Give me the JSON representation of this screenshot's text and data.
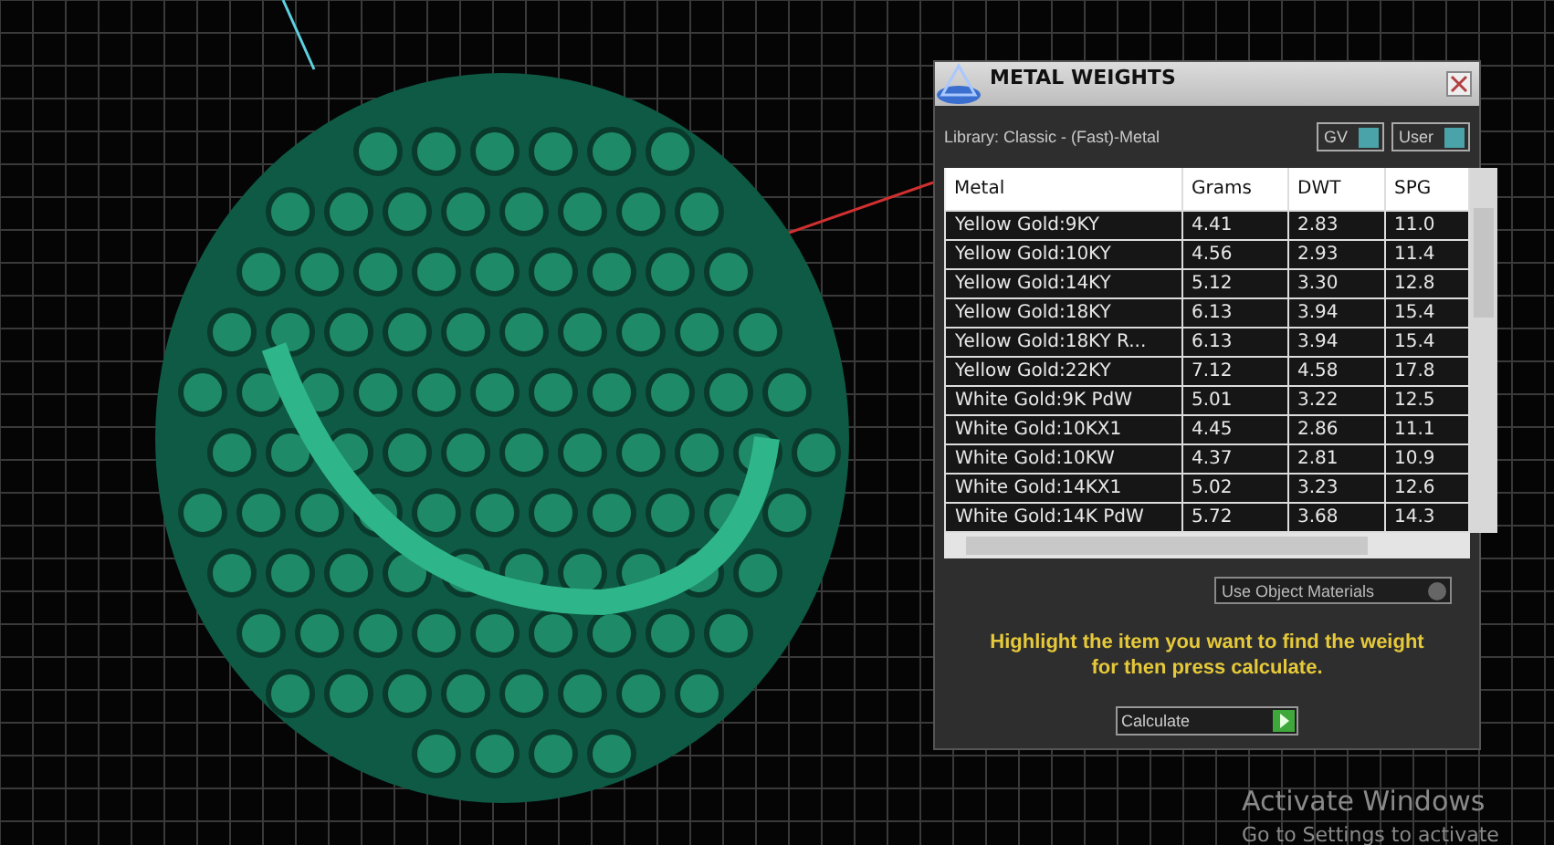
{
  "panel": {
    "title": "METAL WEIGHTS",
    "library": "Library: Classic - (Fast)-Metal",
    "toggles": [
      "GV",
      "User"
    ],
    "table": {
      "columns": [
        "Metal",
        "Grams",
        "DWT",
        "SPG"
      ],
      "rows": [
        [
          "Yellow Gold:9KY",
          "4.41",
          "2.83",
          "11.0"
        ],
        [
          "Yellow Gold:10KY",
          "4.56",
          "2.93",
          "11.4"
        ],
        [
          "Yellow Gold:14KY",
          "5.12",
          "3.30",
          "12.8"
        ],
        [
          "Yellow Gold:18KY",
          "6.13",
          "3.94",
          "15.4"
        ],
        [
          "Yellow Gold:18KY R...",
          "6.13",
          "3.94",
          "15.4"
        ],
        [
          "Yellow Gold:22KY",
          "7.12",
          "4.58",
          "17.8"
        ],
        [
          "White Gold:9K PdW",
          "5.01",
          "3.22",
          "12.5"
        ],
        [
          "White Gold:10KX1",
          "4.45",
          "2.86",
          "11.1"
        ],
        [
          "White Gold:10KW",
          "4.37",
          "2.81",
          "10.9"
        ],
        [
          "White Gold:14KX1",
          "5.02",
          "3.23",
          "12.6"
        ],
        [
          "White Gold:14K PdW",
          "5.72",
          "3.68",
          "14.3"
        ]
      ]
    },
    "use_object_materials": "Use Object Materials",
    "hint": "Highlight the item you want to find the weight for then press calculate.",
    "calculate_button": "Calculate"
  },
  "activation_notice": {
    "title": "Activate Windows",
    "subtitle": "Go to Settings to activate"
  }
}
